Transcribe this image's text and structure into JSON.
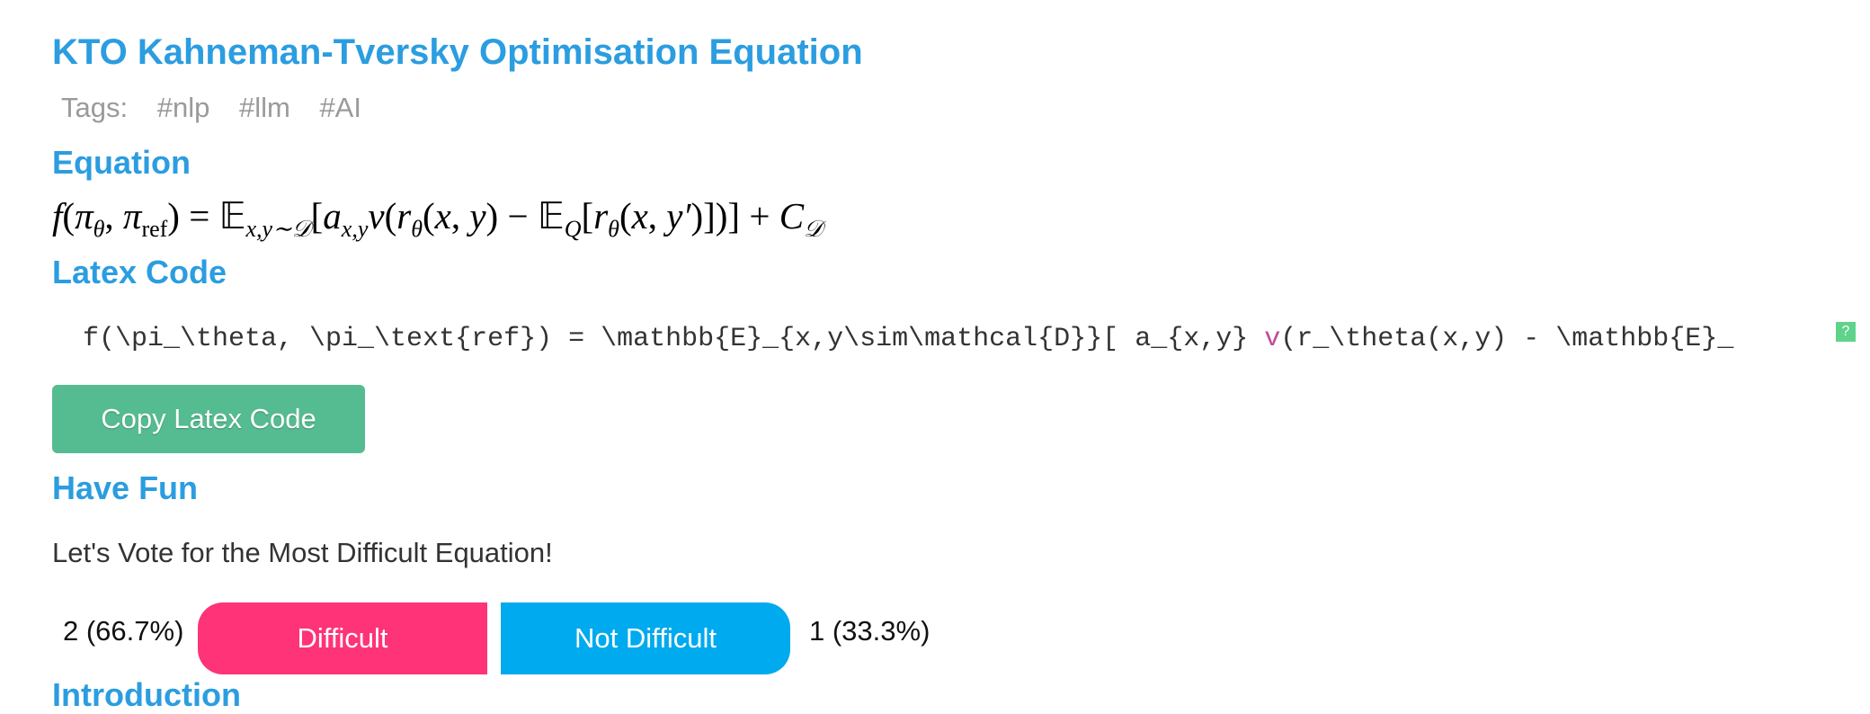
{
  "title": "KTO Kahneman-Tversky Optimisation Equation",
  "tags": {
    "label": "Tags:",
    "items": [
      "#nlp",
      "#llm",
      "#AI"
    ]
  },
  "sections": {
    "equation": "Equation",
    "latex": "Latex Code",
    "fun": "Have Fun",
    "intro": "Introduction"
  },
  "equation": {
    "f": "f",
    "pi": "π",
    "theta": "θ",
    "ref": "ref",
    "E": "𝔼",
    "sub_xy_d": "x,y∼𝒟",
    "a": "a",
    "sub_xy": "x,y",
    "v": "v",
    "r": "r",
    "x": "x",
    "y": "y",
    "yprime": "y′",
    "Q": "Q",
    "C": "C",
    "D": "𝒟"
  },
  "latex_code": {
    "part1": "f(\\pi_\\theta, \\pi_\\text{ref}) =  \\mathbb{E}_{x,y\\sim\\mathcal{D}}[ a_{x,y} ",
    "fn": "v",
    "part2": "(r_\\theta(x,y) - \\mathbb{E}_",
    "badge": "?"
  },
  "copy_button": "Copy Latex Code",
  "vote": {
    "prompt": "Let's Vote for the Most Difficult Equation!",
    "difficult_count": "2 (66.7%)",
    "difficult_label": "Difficult",
    "not_difficult_label": "Not Difficult",
    "not_difficult_count": "1 (33.3%)"
  }
}
